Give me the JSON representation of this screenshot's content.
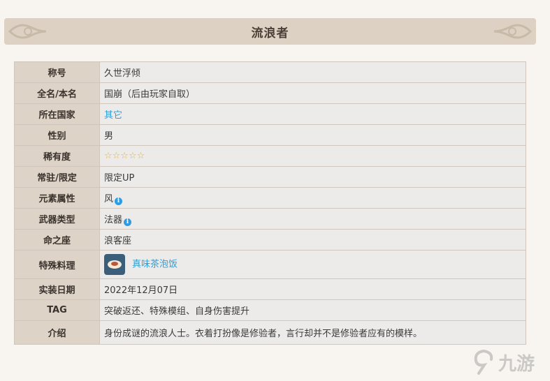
{
  "banner": {
    "title": "流浪者"
  },
  "rows": [
    {
      "label": "称号",
      "value": "久世浮倾"
    },
    {
      "label": "全名/本名",
      "value": "国崩（后由玩家自取）"
    },
    {
      "label": "所在国家",
      "value": "其它"
    },
    {
      "label": "性别",
      "value": "男"
    },
    {
      "label": "稀有度",
      "value": "☆☆☆☆☆",
      "stars": 5
    },
    {
      "label": "常驻/限定",
      "value": "限定UP"
    },
    {
      "label": "元素属性",
      "value": "风"
    },
    {
      "label": "武器类型",
      "value": "法器"
    },
    {
      "label": "命之座",
      "value": "浪客座"
    },
    {
      "label": "特殊料理",
      "value": "真味茶泡饭"
    },
    {
      "label": "实装日期",
      "value": "2022年12月07日"
    },
    {
      "label": "TAG",
      "value": "突破返还、特殊模组、自身伤害提升"
    },
    {
      "label": "介绍",
      "value": "身份成谜的流浪人士。衣着打扮像是修验者，言行却并不是修验者应有的模样。"
    }
  ],
  "icons": {
    "info": "i"
  },
  "watermark": {
    "text": "九游"
  },
  "colors": {
    "link": "#2a9fd6",
    "label_bg": "#ddd3c7",
    "value_bg": "#ecebea",
    "banner_bg": "#dcd1c2"
  }
}
